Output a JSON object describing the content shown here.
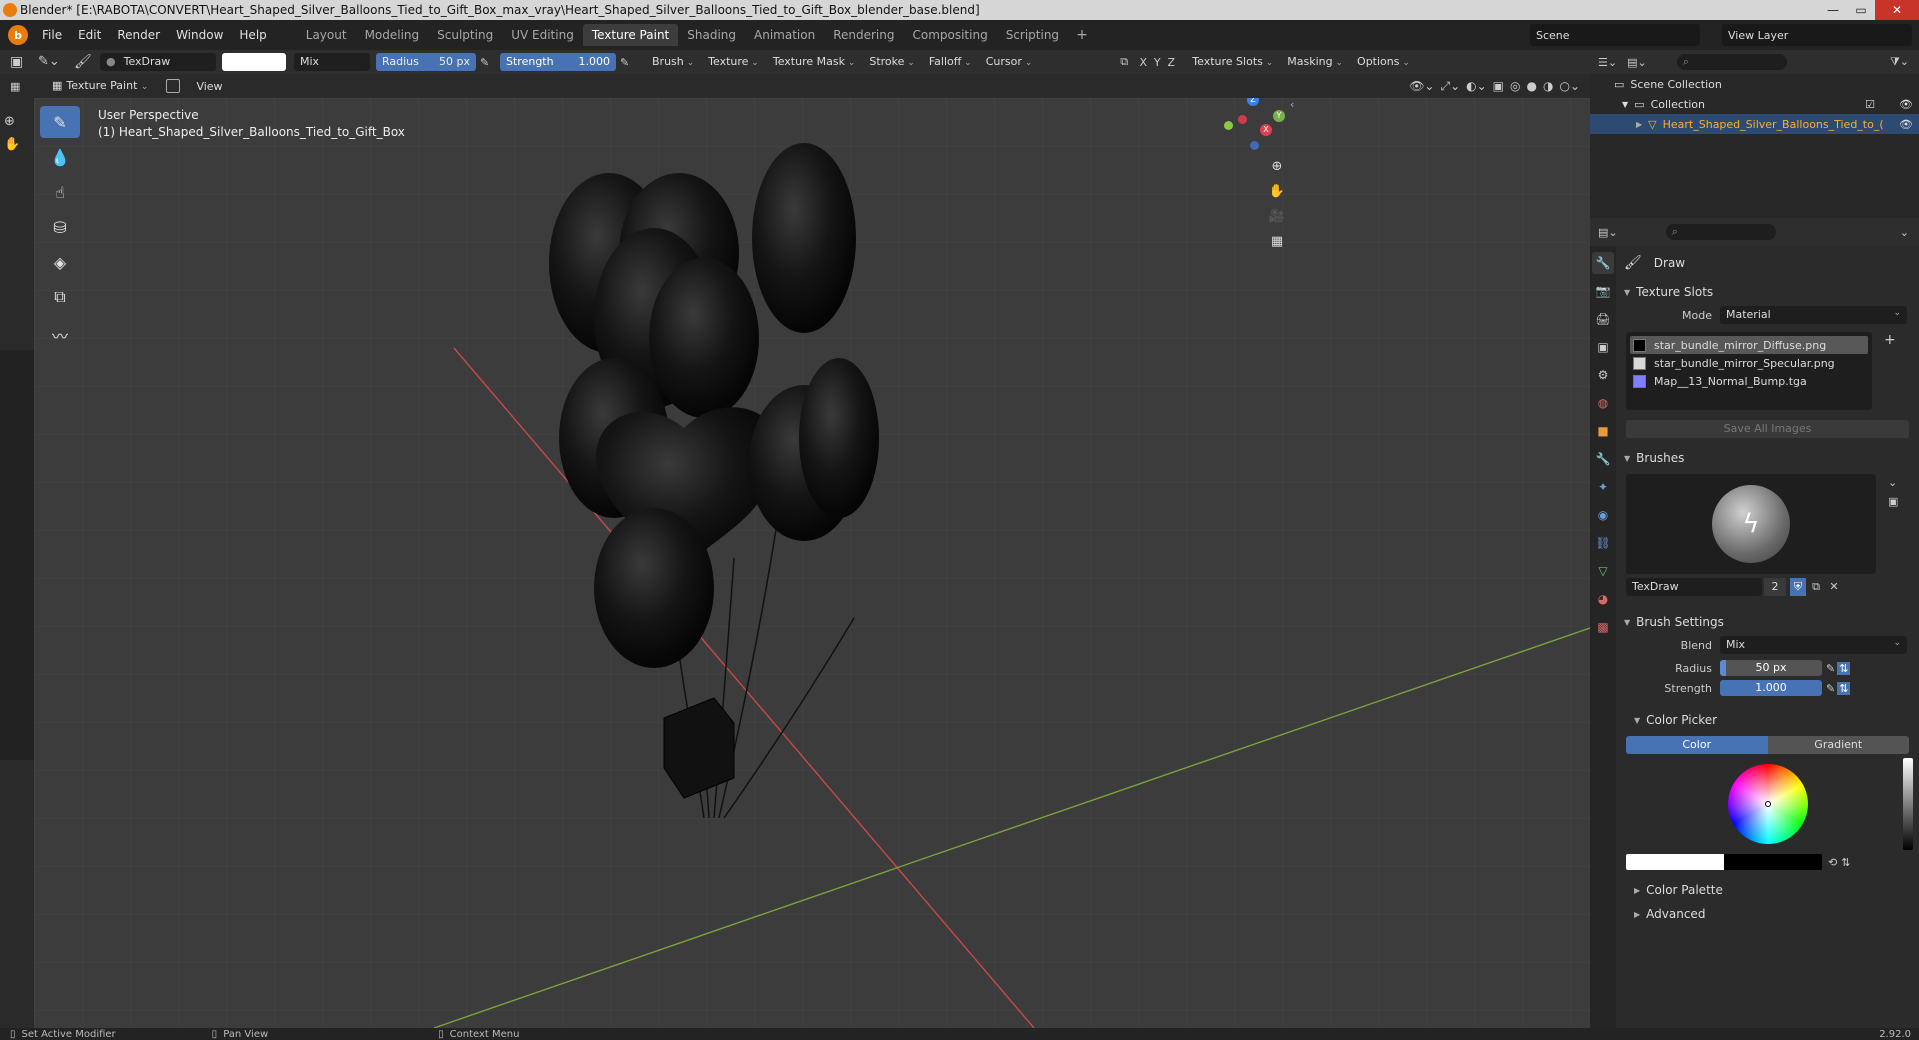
{
  "titlebar": {
    "title": "Blender* [E:\\RABOTA\\CONVERT\\Heart_Shaped_Silver_Balloons_Tied_to_Gift_Box_max_vray\\Heart_Shaped_Silver_Balloons_Tied_to_Gift_Box_blender_base.blend]",
    "minimize": "—",
    "maximize": "▭",
    "close": "✕"
  },
  "menu": {
    "items": [
      "File",
      "Edit",
      "Render",
      "Window",
      "Help"
    ],
    "workspaces": [
      "Layout",
      "Modeling",
      "Sculpting",
      "UV Editing",
      "Texture Paint",
      "Shading",
      "Animation",
      "Rendering",
      "Compositing",
      "Scripting"
    ],
    "active_workspace": "Texture Paint",
    "add_tab": "+",
    "scene": "Scene",
    "view_layer": "View Layer"
  },
  "toolheader": {
    "brush_name": "TexDraw",
    "blend": "Mix",
    "radius_label": "Radius",
    "radius_value": "50 px",
    "strength_label": "Strength",
    "strength_value": "1.000",
    "menus": [
      "Brush",
      "Texture",
      "Texture Mask",
      "Stroke",
      "Falloff",
      "Cursor"
    ],
    "axes": [
      "X",
      "Y",
      "Z"
    ],
    "right_menus": [
      "Texture Slots",
      "Masking",
      "Options"
    ]
  },
  "header2": {
    "mode": "Texture Paint",
    "view": "View"
  },
  "viewport": {
    "perspective": "User Perspective",
    "object": "(1) Heart_Shaped_Silver_Balloons_Tied_to_Gift_Box",
    "gizmo": {
      "x": "X",
      "y": "Y",
      "z": "Z"
    }
  },
  "outliner": {
    "scene_collection": "Scene Collection",
    "collection": "Collection",
    "object": "Heart_Shaped_Silver_Balloons_Tied_to_("
  },
  "properties": {
    "tool_name": "Draw",
    "texture_slots": {
      "title": "Texture Slots",
      "mode_label": "Mode",
      "mode_value": "Material",
      "slots": [
        {
          "name": "star_bundle_mirror_Diffuse.png",
          "color": "#000000"
        },
        {
          "name": "star_bundle_mirror_Specular.png",
          "color": "#d8d8d8"
        },
        {
          "name": "Map__13_Normal_Bump.tga",
          "color": "#8080ff"
        }
      ],
      "save_all": "Save All Images"
    },
    "brushes": {
      "title": "Brushes",
      "name": "TexDraw",
      "users": "2"
    },
    "brush_settings": {
      "title": "Brush Settings",
      "blend_label": "Blend",
      "blend_value": "Mix",
      "radius_label": "Radius",
      "radius_value": "50 px",
      "strength_label": "Strength",
      "strength_value": "1.000"
    },
    "color_picker": {
      "title": "Color Picker",
      "tab_color": "Color",
      "tab_gradient": "Gradient"
    },
    "color_palette": "Color Palette",
    "advanced": "Advanced"
  },
  "status": {
    "left": "Set Active Modifier",
    "middle": "Pan View",
    "right": "Context Menu",
    "version": "2.92.0"
  },
  "colors": {
    "accent": "#4772b3",
    "selected_object": "#ffaf29",
    "blender_orange": "#e87d0d"
  }
}
